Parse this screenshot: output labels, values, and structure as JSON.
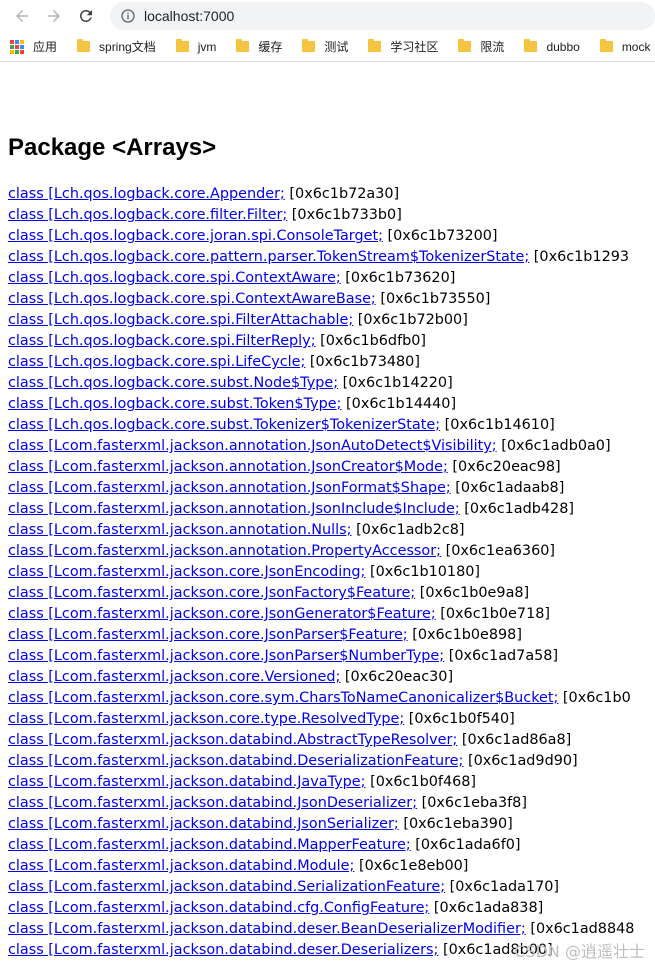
{
  "browser": {
    "url": "localhost:7000",
    "bookmarks": [
      "应用",
      "spring文档",
      "jvm",
      "缓存",
      "测试",
      "学习社区",
      "限流",
      "dubbo",
      "mock"
    ]
  },
  "page": {
    "title": "Package <Arrays>",
    "entries": [
      {
        "link": "class [Lch.qos.logback.core.Appender;",
        "addr": " [0x6c1b72a30]"
      },
      {
        "link": "class [Lch.qos.logback.core.filter.Filter;",
        "addr": " [0x6c1b733b0]"
      },
      {
        "link": "class [Lch.qos.logback.core.joran.spi.ConsoleTarget;",
        "addr": " [0x6c1b73200]"
      },
      {
        "link": "class [Lch.qos.logback.core.pattern.parser.TokenStream$TokenizerState;",
        "addr": " [0x6c1b1293"
      },
      {
        "link": "class [Lch.qos.logback.core.spi.ContextAware;",
        "addr": " [0x6c1b73620]"
      },
      {
        "link": "class [Lch.qos.logback.core.spi.ContextAwareBase;",
        "addr": " [0x6c1b73550]"
      },
      {
        "link": "class [Lch.qos.logback.core.spi.FilterAttachable;",
        "addr": " [0x6c1b72b00]"
      },
      {
        "link": "class [Lch.qos.logback.core.spi.FilterReply;",
        "addr": " [0x6c1b6dfb0]"
      },
      {
        "link": "class [Lch.qos.logback.core.spi.LifeCycle;",
        "addr": " [0x6c1b73480]"
      },
      {
        "link": "class [Lch.qos.logback.core.subst.Node$Type;",
        "addr": " [0x6c1b14220]"
      },
      {
        "link": "class [Lch.qos.logback.core.subst.Token$Type;",
        "addr": " [0x6c1b14440]"
      },
      {
        "link": "class [Lch.qos.logback.core.subst.Tokenizer$TokenizerState;",
        "addr": " [0x6c1b14610]"
      },
      {
        "link": "class [Lcom.fasterxml.jackson.annotation.JsonAutoDetect$Visibility;",
        "addr": " [0x6c1adb0a0]"
      },
      {
        "link": "class [Lcom.fasterxml.jackson.annotation.JsonCreator$Mode;",
        "addr": " [0x6c20eac98]"
      },
      {
        "link": "class [Lcom.fasterxml.jackson.annotation.JsonFormat$Shape;",
        "addr": " [0x6c1adaab8]"
      },
      {
        "link": "class [Lcom.fasterxml.jackson.annotation.JsonInclude$Include;",
        "addr": " [0x6c1adb428]"
      },
      {
        "link": "class [Lcom.fasterxml.jackson.annotation.Nulls;",
        "addr": " [0x6c1adb2c8]"
      },
      {
        "link": "class [Lcom.fasterxml.jackson.annotation.PropertyAccessor;",
        "addr": " [0x6c1ea6360]"
      },
      {
        "link": "class [Lcom.fasterxml.jackson.core.JsonEncoding;",
        "addr": " [0x6c1b10180]"
      },
      {
        "link": "class [Lcom.fasterxml.jackson.core.JsonFactory$Feature;",
        "addr": " [0x6c1b0e9a8]"
      },
      {
        "link": "class [Lcom.fasterxml.jackson.core.JsonGenerator$Feature;",
        "addr": " [0x6c1b0e718]"
      },
      {
        "link": "class [Lcom.fasterxml.jackson.core.JsonParser$Feature;",
        "addr": " [0x6c1b0e898]"
      },
      {
        "link": "class [Lcom.fasterxml.jackson.core.JsonParser$NumberType;",
        "addr": " [0x6c1ad7a58]"
      },
      {
        "link": "class [Lcom.fasterxml.jackson.core.Versioned;",
        "addr": " [0x6c20eac30]"
      },
      {
        "link": "class [Lcom.fasterxml.jackson.core.sym.CharsToNameCanonicalizer$Bucket;",
        "addr": " [0x6c1b0"
      },
      {
        "link": "class [Lcom.fasterxml.jackson.core.type.ResolvedType;",
        "addr": " [0x6c1b0f540]"
      },
      {
        "link": "class [Lcom.fasterxml.jackson.databind.AbstractTypeResolver;",
        "addr": " [0x6c1ad86a8]"
      },
      {
        "link": "class [Lcom.fasterxml.jackson.databind.DeserializationFeature;",
        "addr": " [0x6c1ad9d90]"
      },
      {
        "link": "class [Lcom.fasterxml.jackson.databind.JavaType;",
        "addr": " [0x6c1b0f468]"
      },
      {
        "link": "class [Lcom.fasterxml.jackson.databind.JsonDeserializer;",
        "addr": " [0x6c1eba3f8]"
      },
      {
        "link": "class [Lcom.fasterxml.jackson.databind.JsonSerializer;",
        "addr": " [0x6c1eba390]"
      },
      {
        "link": "class [Lcom.fasterxml.jackson.databind.MapperFeature;",
        "addr": " [0x6c1ada6f0]"
      },
      {
        "link": "class [Lcom.fasterxml.jackson.databind.Module;",
        "addr": " [0x6c1e8eb00]"
      },
      {
        "link": "class [Lcom.fasterxml.jackson.databind.SerializationFeature;",
        "addr": " [0x6c1ada170]"
      },
      {
        "link": "class [Lcom.fasterxml.jackson.databind.cfg.ConfigFeature;",
        "addr": " [0x6c1ada838]"
      },
      {
        "link": "class [Lcom.fasterxml.jackson.databind.deser.BeanDeserializerModifier;",
        "addr": " [0x6c1ad8848"
      },
      {
        "link": "class [Lcom.fasterxml.jackson.databind.deser.Deserializers;",
        "addr": " [0x6c1ad8b00]"
      }
    ],
    "watermark": "CSDN @逍遥壮士"
  }
}
